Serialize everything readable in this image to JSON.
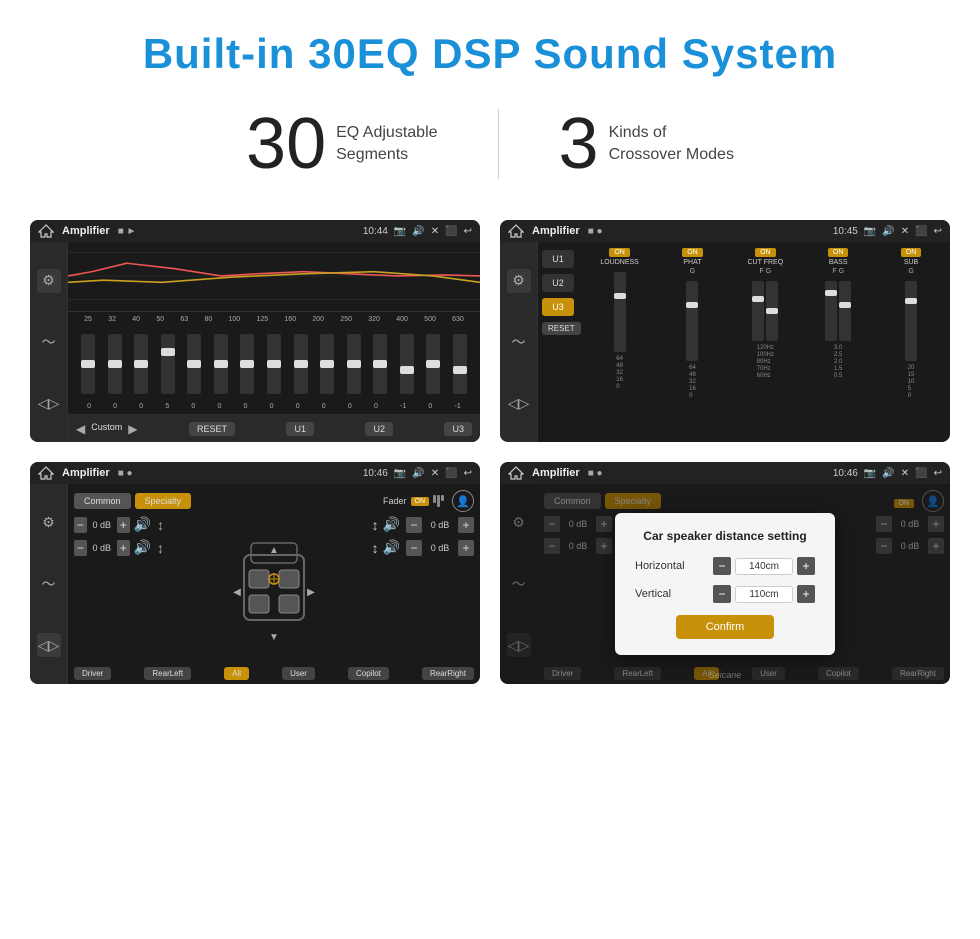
{
  "header": {
    "title": "Built-in 30EQ DSP Sound System"
  },
  "stats": {
    "eq_number": "30",
    "eq_label_line1": "EQ Adjustable",
    "eq_label_line2": "Segments",
    "crossover_number": "3",
    "crossover_label_line1": "Kinds of",
    "crossover_label_line2": "Crossover Modes"
  },
  "screen1": {
    "title": "Amplifier",
    "time": "10:44",
    "mode": "Custom",
    "eq_freqs": [
      "25",
      "32",
      "40",
      "50",
      "63",
      "80",
      "100",
      "125",
      "160",
      "200",
      "250",
      "320",
      "400",
      "500",
      "630"
    ],
    "eq_values": [
      "0",
      "0",
      "0",
      "5",
      "0",
      "0",
      "0",
      "0",
      "0",
      "0",
      "0",
      "0",
      "-1",
      "0",
      "-1"
    ],
    "buttons": [
      "RESET",
      "U1",
      "U2",
      "U3"
    ]
  },
  "screen2": {
    "title": "Amplifier",
    "time": "10:45",
    "u_buttons": [
      "U1",
      "U2",
      "U3"
    ],
    "active_u": "U3",
    "channels": [
      {
        "on": true,
        "label": "LOUDNESS",
        "sublabel": ""
      },
      {
        "on": true,
        "label": "PHAT",
        "sublabel": "G"
      },
      {
        "on": true,
        "label": "CUT FREQ",
        "sublabel": "F G"
      },
      {
        "on": true,
        "label": "BASS",
        "sublabel": "F G"
      },
      {
        "on": true,
        "label": "SUB",
        "sublabel": "G"
      }
    ],
    "reset_label": "RESET"
  },
  "screen3": {
    "title": "Amplifier",
    "time": "10:46",
    "mode_buttons": [
      "Common",
      "Specialty"
    ],
    "active_mode": "Specialty",
    "fader_label": "Fader",
    "fader_on": "ON",
    "db_left_top": "0 dB",
    "db_left_bottom": "0 dB",
    "db_right_top": "0 dB",
    "db_right_bottom": "0 dB",
    "positions": [
      "Driver",
      "RearLeft",
      "All",
      "User",
      "Copilot",
      "RearRight"
    ]
  },
  "screen4": {
    "title": "Amplifier",
    "time": "10:46",
    "dialog": {
      "title": "Car speaker distance setting",
      "horizontal_label": "Horizontal",
      "horizontal_value": "140cm",
      "vertical_label": "Vertical",
      "vertical_value": "110cm",
      "confirm_label": "Confirm"
    },
    "db_right_top": "0 dB",
    "db_right_bottom": "0 dB",
    "positions": [
      "Driver",
      "RearLeft",
      "All",
      "User",
      "Copilot",
      "RearRight"
    ]
  },
  "watermark": "Seicane"
}
